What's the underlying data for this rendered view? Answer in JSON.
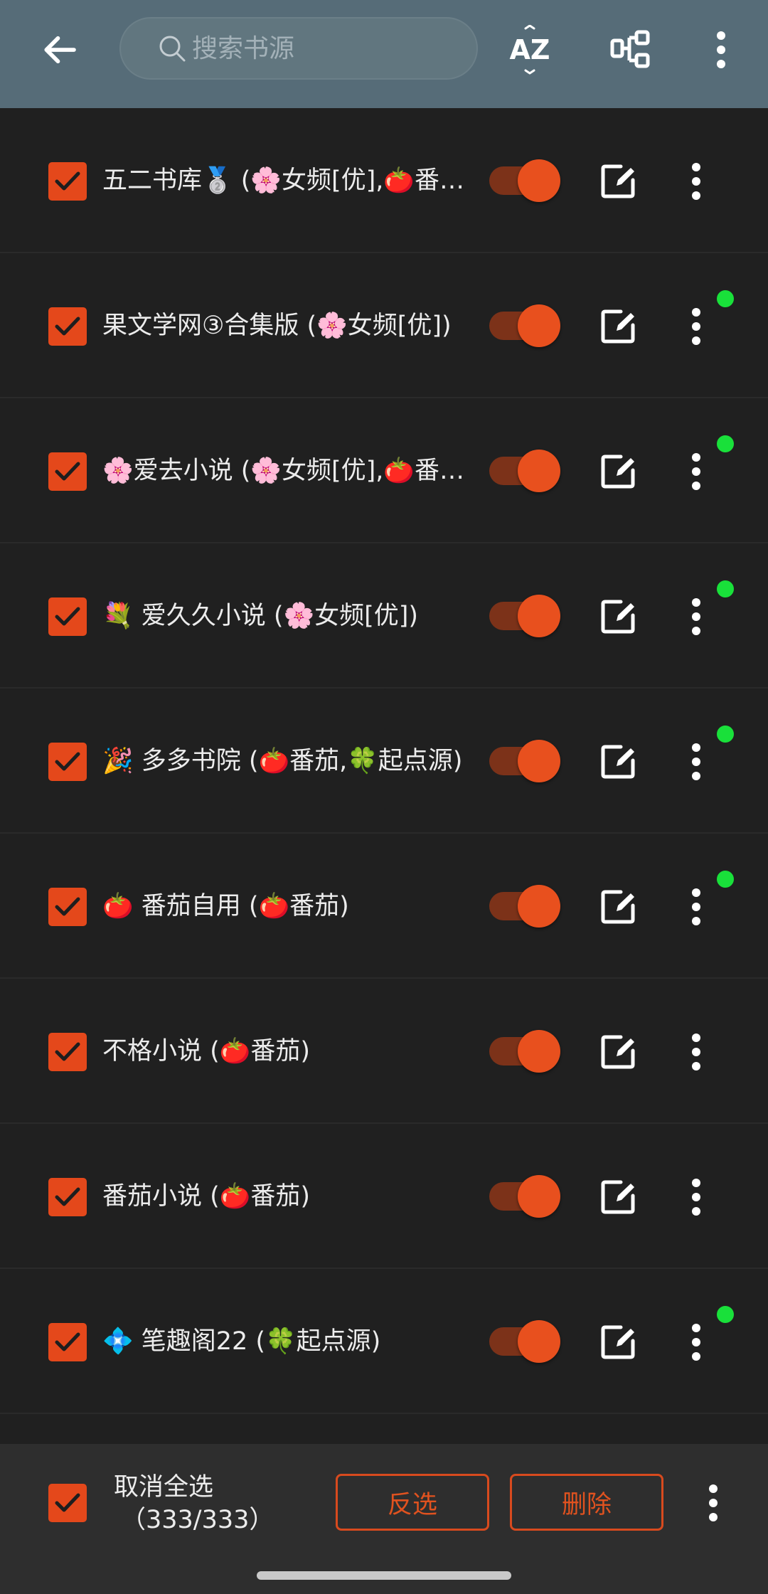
{
  "header": {
    "search_placeholder": "搜索书源",
    "sort_label": "AZ"
  },
  "colors": {
    "accent": "#e4481b",
    "header_bg": "#566c78",
    "status_dot": "#19e03a",
    "background": "#202020"
  },
  "sources": [
    {
      "title": "五二书库🥈 (🌸女频[优],🍅番茄)",
      "checked": true,
      "enabled": true,
      "status_dot": false
    },
    {
      "title": "果文学网③合集版 (🌸女频[优])",
      "checked": true,
      "enabled": true,
      "status_dot": true
    },
    {
      "title": "🌸爱去小说 (🌸女频[优],🍅番茄)",
      "checked": true,
      "enabled": true,
      "status_dot": true
    },
    {
      "title": "💐 爱久久小说 (🌸女频[优])",
      "checked": true,
      "enabled": true,
      "status_dot": true
    },
    {
      "title": "🎉 多多书院 (🍅番茄,🍀起点源)",
      "checked": true,
      "enabled": true,
      "status_dot": true
    },
    {
      "title": "🍅 番茄自用 (🍅番茄)",
      "checked": true,
      "enabled": true,
      "status_dot": true
    },
    {
      "title": "不格小说 (🍅番茄)",
      "checked": true,
      "enabled": true,
      "status_dot": false
    },
    {
      "title": "番茄小说 (🍅番茄)",
      "checked": true,
      "enabled": true,
      "status_dot": false
    },
    {
      "title": "💠 笔趣阁22 (🍀起点源)",
      "checked": true,
      "enabled": true,
      "status_dot": true
    }
  ],
  "footer": {
    "deselect_all": "取消全选",
    "count": "（333/333）",
    "invert_label": "反选",
    "delete_label": "删除"
  }
}
